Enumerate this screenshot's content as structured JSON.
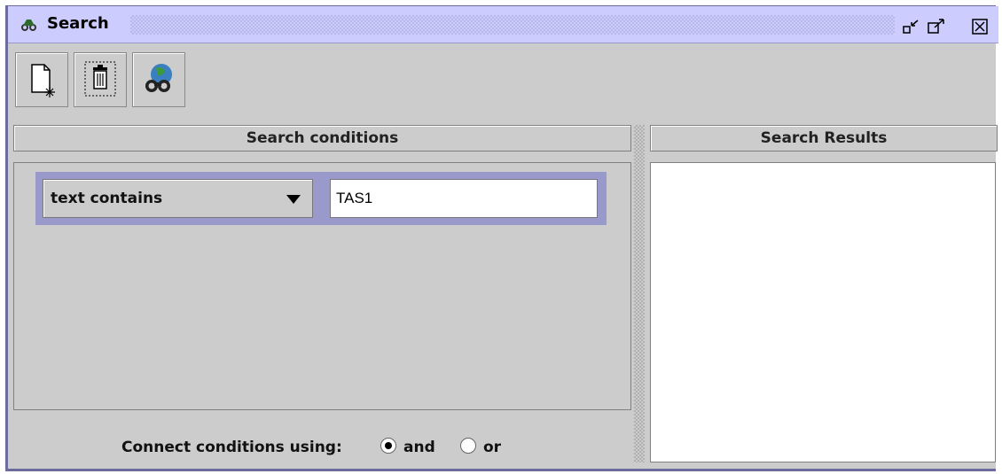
{
  "window": {
    "title": "Search"
  },
  "toolbar": {
    "buttons": [
      {
        "icon": "new-document-icon"
      },
      {
        "icon": "trash-icon"
      },
      {
        "icon": "search-binoculars-icon"
      }
    ]
  },
  "conditions": {
    "header": "Search conditions",
    "rows": [
      {
        "field": "text contains",
        "value": "TAS1"
      }
    ],
    "connect_label": "Connect conditions using:",
    "connect_options": [
      {
        "label": "and",
        "selected": true
      },
      {
        "label": "or",
        "selected": false
      }
    ]
  },
  "results": {
    "header": "Search Results"
  },
  "colors": {
    "titlebar": "#ccccff",
    "frame": "#6c6c9c",
    "condition_row": "#9999cc",
    "panel": "#cccccc"
  }
}
